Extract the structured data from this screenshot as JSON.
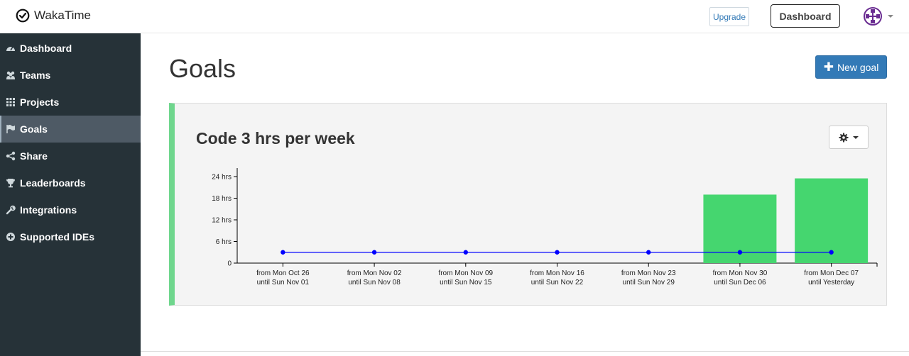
{
  "app": {
    "name": "WakaTime"
  },
  "header": {
    "upgrade_label": "Upgrade",
    "dashboard_label": "Dashboard"
  },
  "sidebar": {
    "items": [
      {
        "label": "Dashboard",
        "icon": "dashboard-icon"
      },
      {
        "label": "Teams",
        "icon": "users-icon"
      },
      {
        "label": "Projects",
        "icon": "grid-icon"
      },
      {
        "label": "Goals",
        "icon": "flag-icon",
        "active": true
      },
      {
        "label": "Share",
        "icon": "share-icon"
      },
      {
        "label": "Leaderboards",
        "icon": "trophy-icon"
      },
      {
        "label": "Integrations",
        "icon": "wrench-icon"
      },
      {
        "label": "Supported IDEs",
        "icon": "plus-circle-icon"
      }
    ]
  },
  "main": {
    "title": "Goals",
    "new_goal_label": "New goal"
  },
  "goal": {
    "title": "Code 3 hrs per week",
    "accent_color": "#6fd68d"
  },
  "chart_data": {
    "type": "bar",
    "categories": [
      [
        "from Mon Oct 26",
        "until Sun Nov 01"
      ],
      [
        "from Mon Nov 02",
        "until Sun Nov 08"
      ],
      [
        "from Mon Nov 09",
        "until Sun Nov 15"
      ],
      [
        "from Mon Nov 16",
        "until Sun Nov 22"
      ],
      [
        "from Mon Nov 23",
        "until Sun Nov 29"
      ],
      [
        "from Mon Nov 30",
        "until Sun Dec 06"
      ],
      [
        "from Mon Dec 07",
        "until Yesterday"
      ]
    ],
    "series": [
      {
        "type": "bar",
        "values": [
          0,
          0,
          0,
          0,
          0,
          19,
          23.5
        ],
        "color": "#45d66f"
      },
      {
        "type": "line",
        "values": [
          3,
          3,
          3,
          3,
          3,
          3,
          3
        ],
        "color": "#0000ff"
      }
    ],
    "yticks": [
      "0",
      "6 hrs",
      "12 hrs",
      "18 hrs",
      "24 hrs"
    ],
    "ytick_values": [
      0,
      6,
      12,
      18,
      24
    ],
    "ylim": [
      0,
      24
    ]
  }
}
